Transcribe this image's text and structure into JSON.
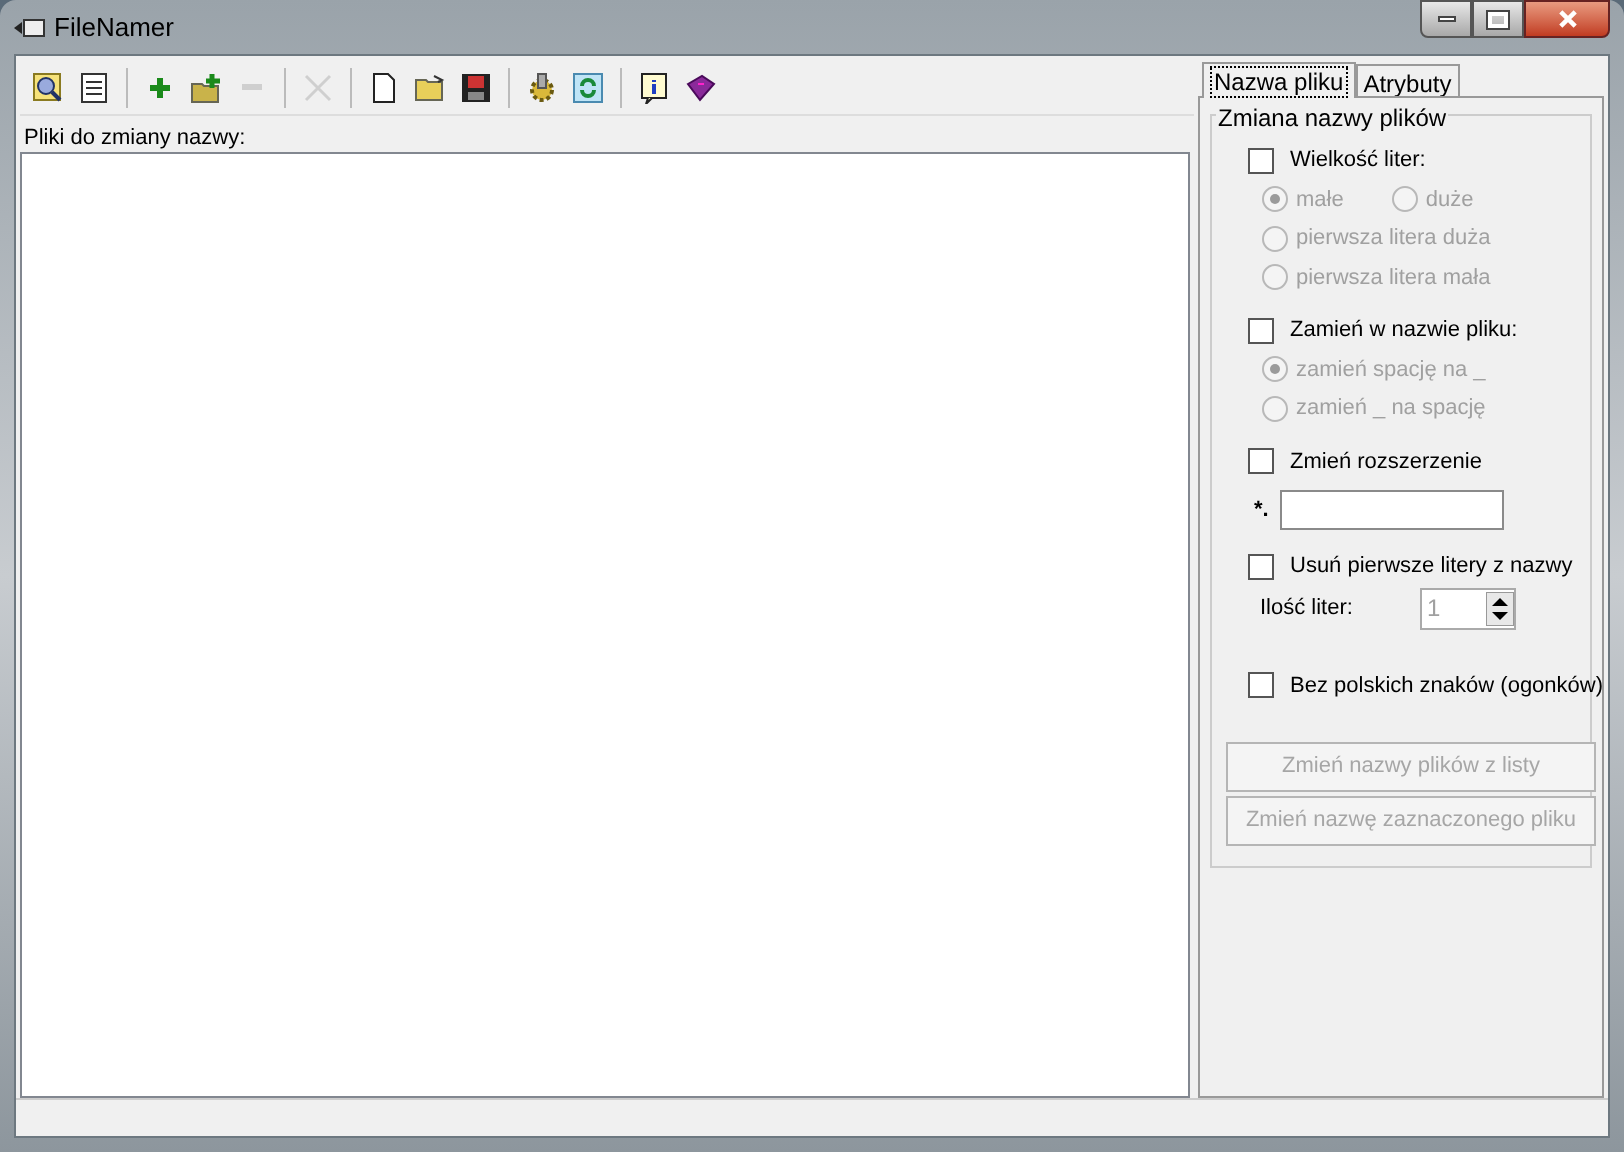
{
  "window": {
    "title": "FileNamer"
  },
  "toolbar": [
    {
      "kind": "button",
      "disabled": false
    },
    {
      "kind": "button",
      "disabled": false
    },
    {
      "kind": "separator"
    },
    {
      "kind": "button",
      "disabled": false
    },
    {
      "kind": "button",
      "disabled": false
    },
    {
      "kind": "button",
      "disabled": true
    },
    {
      "kind": "separator"
    },
    {
      "kind": "button",
      "disabled": true
    },
    {
      "kind": "separator"
    },
    {
      "kind": "button",
      "disabled": false
    },
    {
      "kind": "button",
      "disabled": false
    },
    {
      "kind": "button",
      "disabled": false
    },
    {
      "kind": "separator"
    },
    {
      "kind": "button",
      "disabled": false
    },
    {
      "kind": "button",
      "disabled": false
    },
    {
      "kind": "separator"
    },
    {
      "kind": "button",
      "disabled": false
    },
    {
      "kind": "button",
      "disabled": false
    }
  ],
  "file_list": {
    "label": "Pliki do zmiany nazwy:"
  },
  "tabs": [
    {
      "label": "Nazwa pliku",
      "selected": true
    },
    {
      "label": "Atrybuty",
      "selected": false
    }
  ],
  "group": {
    "title": "Zmiana nazwy plików",
    "case": {
      "label": "Wielkość liter:",
      "checked": false,
      "options": [
        {
          "label": "małe",
          "selected": true,
          "disabled": true
        },
        {
          "label": "duże",
          "selected": false,
          "disabled": true
        },
        {
          "label": "pierwsza litera duża",
          "selected": false,
          "disabled": true
        },
        {
          "label": "pierwsza litera mała",
          "selected": false,
          "disabled": true
        }
      ]
    },
    "replace": {
      "label": "Zamień w nazwie pliku:",
      "checked": false,
      "options": [
        {
          "label": "zamień spację na _",
          "selected": true,
          "disabled": true
        },
        {
          "label": "zamień _ na spację",
          "selected": false,
          "disabled": true
        }
      ]
    },
    "extension": {
      "label": "Zmień rozszerzenie",
      "checked": false,
      "prefix": "*."
    },
    "strip": {
      "label": "Usuń pierwsze litery z nazwy",
      "checked": false,
      "count_label": "Ilość liter:",
      "count": "1",
      "disabled": true
    },
    "polish": {
      "label": "Bez polskich znaków (ogonków)",
      "checked": false
    },
    "buttons": [
      {
        "label": "Zmień nazwy plików z listy",
        "disabled": true
      },
      {
        "label": "Zmień nazwę zaznaczonego pliku",
        "disabled": true
      }
    ]
  }
}
